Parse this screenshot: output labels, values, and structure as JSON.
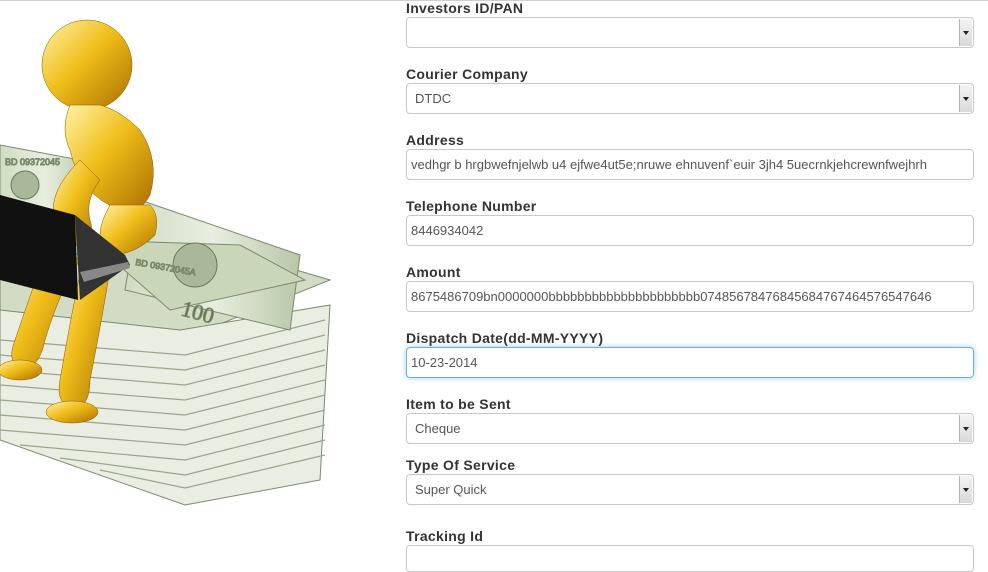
{
  "form": {
    "investors_id": {
      "label": "Investors ID/PAN",
      "value": ""
    },
    "courier_company": {
      "label": "Courier Company",
      "value": "DTDC"
    },
    "address": {
      "label": "Address",
      "value": "vedhgr b hrgbwefnjelwb u4 ejfwe4ut5e;nruwe  ehnuvenf`euir 3jh4 5uecrnkjehcrewnfwejhrh"
    },
    "telephone": {
      "label": "Telephone Number",
      "value": "8446934042"
    },
    "amount": {
      "label": "Amount",
      "value": "8675486709bn0000000bbbbbbbbbbbbbbbbbbbbb07485678476845684767464576547646"
    },
    "dispatch_date": {
      "label": "Dispatch Date(dd-MM-YYYY)",
      "value": "10-23-2014"
    },
    "item": {
      "label": "Item to be Sent",
      "value": "Cheque"
    },
    "service": {
      "label": "Type Of Service",
      "value": "Super Quick"
    },
    "tracking": {
      "label": "Tracking Id",
      "value": ""
    }
  },
  "illustration": {
    "name": "gold-figure-on-money-stack",
    "colors": {
      "gold": "#e0a800",
      "money": "#b7c8a8"
    }
  }
}
